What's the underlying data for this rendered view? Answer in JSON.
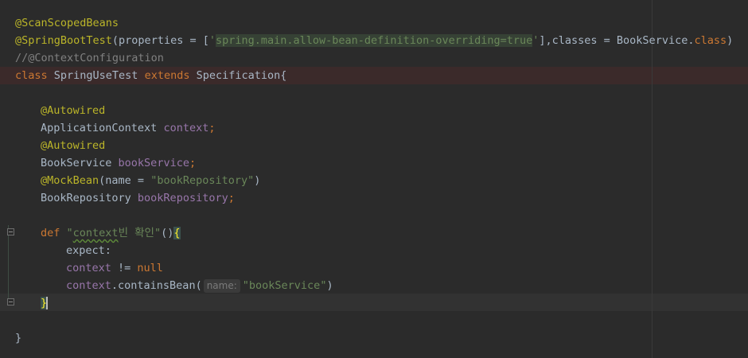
{
  "lines": {
    "l1_anno": "@ScanScopedBeans",
    "l2_anno": "@SpringBootTest",
    "l2_paren": "(properties = [",
    "l2_q1": "'",
    "l2_str": "spring.main.allow-bean-definition-overriding=true",
    "l2_q2": "'",
    "l2_mid": "],classes = BookService.",
    "l2_kw": "class",
    "l2_end": ")",
    "l3_comment": "//@ContextConfiguration",
    "l4_kw1": "class",
    "l4_name": " SpringUseTest ",
    "l4_kw2": "extends",
    "l4_rest": " Specification{",
    "l6_anno": "@Autowired",
    "l7_type": "ApplicationContext ",
    "l7_field": "context",
    "l7_semi": ";",
    "l8_anno": "@Autowired",
    "l9_type": "BookService ",
    "l9_field": "bookService",
    "l9_semi": ";",
    "l10_anno": "@MockBean",
    "l10_paren": "(name = ",
    "l10_str": "\"bookRepository\"",
    "l10_end": ")",
    "l11_type": "BookRepository ",
    "l11_field": "bookRepository",
    "l11_semi": ";",
    "l13_kw": "def ",
    "l13_q": "\"",
    "l13_str_a": "context",
    "l13_str_b": "빈",
    "l13_str_c": " 확인\"",
    "l13_paren": "()",
    "l13_brace": "{",
    "l14_label": "expect:",
    "l15_field": "context",
    "l15_op": " != ",
    "l15_kw": "null",
    "l16_field": "context",
    "l16_call": ".containsBean(",
    "l16_hint": "name:",
    "l16_str": "\"bookService\"",
    "l16_end": ")",
    "l17_brace": "}",
    "l19_brace": "}"
  }
}
